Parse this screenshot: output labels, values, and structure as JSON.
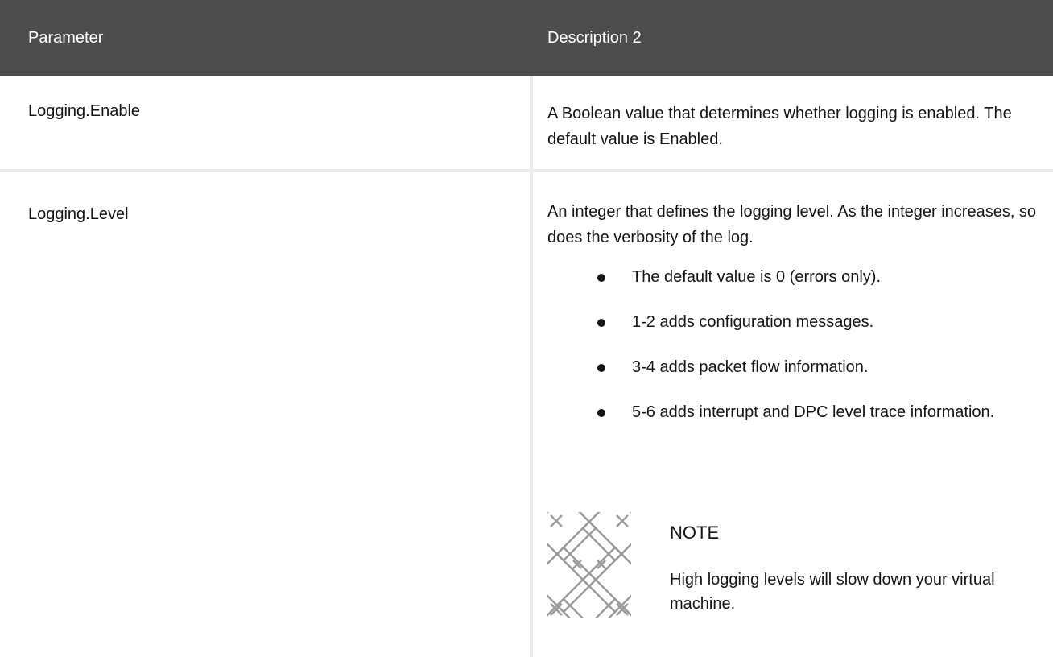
{
  "table": {
    "headers": {
      "parameter": "Parameter",
      "description": "Description 2"
    },
    "rows": [
      {
        "parameter": "Logging.Enable",
        "description": "A Boolean value that determines whether logging is enabled. The default value is Enabled."
      },
      {
        "parameter": "Logging.Level",
        "description": "An integer that defines the logging level. As the integer increases, so does the verbosity of the log.",
        "bullets": [
          "The default value is 0 (errors only).",
          "1-2 adds configuration messages.",
          "3-4 adds packet flow information.",
          "5-6 adds interrupt and DPC level trace information."
        ],
        "note": {
          "icon": "note-pattern-icon",
          "title": "NOTE",
          "text": "High logging levels will slow down your virtual machine."
        }
      }
    ]
  },
  "colors": {
    "header_bg": "#4d4d4d",
    "header_text": "#ffffff",
    "divider": "#ececec",
    "body_text": "#151515"
  }
}
